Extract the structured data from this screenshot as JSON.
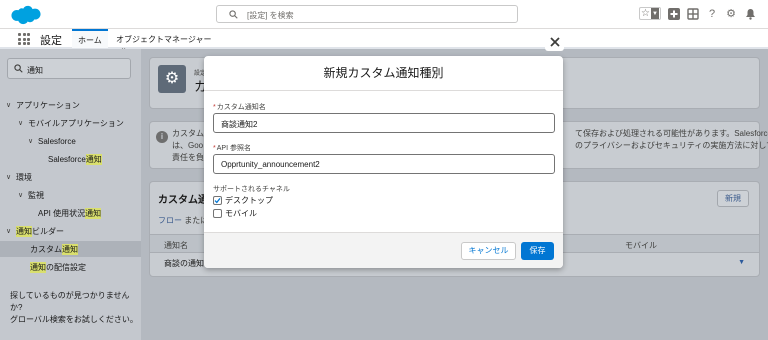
{
  "topbar": {
    "search_placeholder": "[設定] を検索"
  },
  "nav": {
    "app_name": "設定",
    "tabs": [
      {
        "label": "ホーム"
      },
      {
        "label": "オブジェクトマネージャー"
      }
    ]
  },
  "sidebar": {
    "search_value": "通知",
    "tree": [
      {
        "label": "アプリケーション",
        "highlight": ""
      },
      {
        "label": "モバイルアプリケーション",
        "highlight": ""
      },
      {
        "label": "Salesforce",
        "highlight": ""
      },
      {
        "label": "Salesforce ",
        "highlight": "通知"
      },
      {
        "label": "環境",
        "highlight": ""
      },
      {
        "label": "監視",
        "highlight": ""
      },
      {
        "label": "API 使用状況",
        "highlight": "通知"
      },
      {
        "label": "ビルダー",
        "highlight": "通知"
      },
      {
        "label": "カスタム",
        "highlight": "通知"
      },
      {
        "label": "の配信設定",
        "highlight": "通知"
      }
    ],
    "footer_line1": "探しているものが見つかりませんか?",
    "footer_line2": "グローバル検索をお試しください。"
  },
  "main": {
    "header_subtitle": "設定",
    "header_title": "カス",
    "info_left_1": "カスタム",
    "info_left_2": "は、Goo",
    "info_left_3": "責任を負",
    "info_right_1": "て保存および処理される可能性があります。Salesforce",
    "info_right_2": "のプライバシーおよびセキュリティの実施方法に対して",
    "list_title": "カスタム通",
    "new_button": "新規",
    "flow_link": "フロー",
    "flow_suffix": " または",
    "col_name": "通知名",
    "col_mobile": "モバイル",
    "row_name": "商談の通知"
  },
  "modal": {
    "title": "新規カスタム通知種別",
    "name_label": "カスタム通知名",
    "name_value": "商談通知2",
    "api_label": "API 参照名",
    "api_value": "Opprtunity_announcement2",
    "channels_label": "サポートされるチャネル",
    "channel_desktop": "デスクトップ",
    "channel_mobile": "モバイル",
    "desktop_checked": true,
    "mobile_checked": false,
    "cancel_label": "キャンセル",
    "save_label": "保存"
  },
  "colors": {
    "brand_blue": "#0176d3",
    "logo_blue": "#00a1e0",
    "highlight": "#d9df6e",
    "required": "#c23934"
  },
  "icons": [
    "salesforce-logo",
    "search-icon",
    "star-icon",
    "add-icon",
    "setup-assistant-icon",
    "help-icon",
    "gear-icon",
    "bell-icon",
    "waffle-icon",
    "chevron-down-icon",
    "close-icon",
    "info-icon",
    "checkmark-icon"
  ]
}
